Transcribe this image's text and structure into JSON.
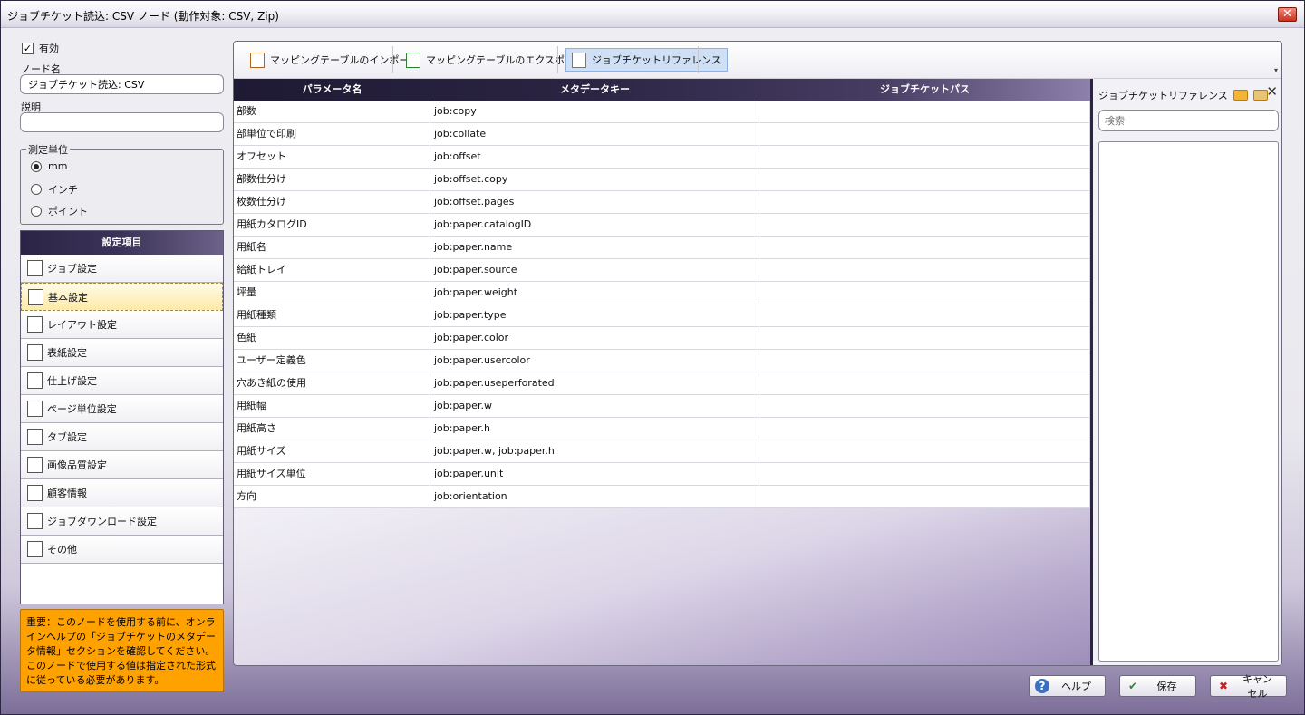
{
  "window": {
    "title": "ジョブチケット読込: CSV ノード (動作対象: CSV, Zip)",
    "close_glyph": "✕"
  },
  "left": {
    "enabled_label": "有効",
    "enabled_check": "✓",
    "node_name_label": "ノード名",
    "node_name_value": "ジョブチケット読込: CSV",
    "description_label": "説明",
    "description_value": "",
    "unit_group_label": "測定単位",
    "units": [
      "mm",
      "インチ",
      "ポイント"
    ],
    "settings_header": "設定項目",
    "settings_items": [
      {
        "label": "ジョブ設定",
        "icon": "document-icon"
      },
      {
        "label": "基本設定",
        "icon": "list-icon"
      },
      {
        "label": "レイアウト設定",
        "icon": "layout-icon"
      },
      {
        "label": "表紙設定",
        "icon": "cover-icon"
      },
      {
        "label": "仕上げ設定",
        "icon": "finishing-icon"
      },
      {
        "label": "ページ単位設定",
        "icon": "pages-icon"
      },
      {
        "label": "タブ設定",
        "icon": "tab-icon"
      },
      {
        "label": "画像品質設定",
        "icon": "image-icon"
      },
      {
        "label": "顧客情報",
        "icon": "customer-icon"
      },
      {
        "label": "ジョブダウンロード設定",
        "icon": "download-icon"
      },
      {
        "label": "その他",
        "icon": "other-icon"
      }
    ],
    "note": "重要：このノードを使用する前に、オンラインヘルプの「ジョブチケットのメタデータ情報」セクションを確認してください。このノードで使用する値は指定された形式に従っている必要があります。"
  },
  "toolbar": {
    "import_label": "マッピングテーブルのインポート",
    "export_label": "マッピングテーブルのエクスポート",
    "reference_label": "ジョブチケットリファレンス",
    "overflow_glyph": "▾"
  },
  "table": {
    "headers": [
      "パラメータ名",
      "メタデータキー",
      "ジョブチケットパス"
    ],
    "rows": [
      [
        "部数",
        "job:copy",
        ""
      ],
      [
        "部単位で印刷",
        "job:collate",
        ""
      ],
      [
        "オフセット",
        "job:offset",
        ""
      ],
      [
        "部数仕分け",
        "job:offset.copy",
        ""
      ],
      [
        "枚数仕分け",
        "job:offset.pages",
        ""
      ],
      [
        "用紙カタログID",
        "job:paper.catalogID",
        ""
      ],
      [
        "用紙名",
        "job:paper.name",
        ""
      ],
      [
        "給紙トレイ",
        "job:paper.source",
        ""
      ],
      [
        "坪量",
        "job:paper.weight",
        ""
      ],
      [
        "用紙種類",
        "job:paper.type",
        ""
      ],
      [
        "色紙",
        "job:paper.color",
        ""
      ],
      [
        "ユーザー定義色",
        "job:paper.usercolor",
        ""
      ],
      [
        "穴あき紙の使用",
        "job:paper.useperforated",
        ""
      ],
      [
        "用紙幅",
        "job:paper.w",
        ""
      ],
      [
        "用紙高さ",
        "job:paper.h",
        ""
      ],
      [
        "用紙サイズ",
        "job:paper.w, job:paper.h",
        ""
      ],
      [
        "用紙サイズ単位",
        "job:paper.unit",
        ""
      ],
      [
        "方向",
        "job:orientation",
        ""
      ]
    ]
  },
  "side_panel": {
    "title": "ジョブチケットリファレンス",
    "search_placeholder": "検索",
    "close_glyph": "✕"
  },
  "buttons": {
    "help": "ヘルプ",
    "help_glyph": "?",
    "save": "保存",
    "save_glyph": "✔",
    "cancel": "キャンセル",
    "cancel_glyph": "✖"
  }
}
